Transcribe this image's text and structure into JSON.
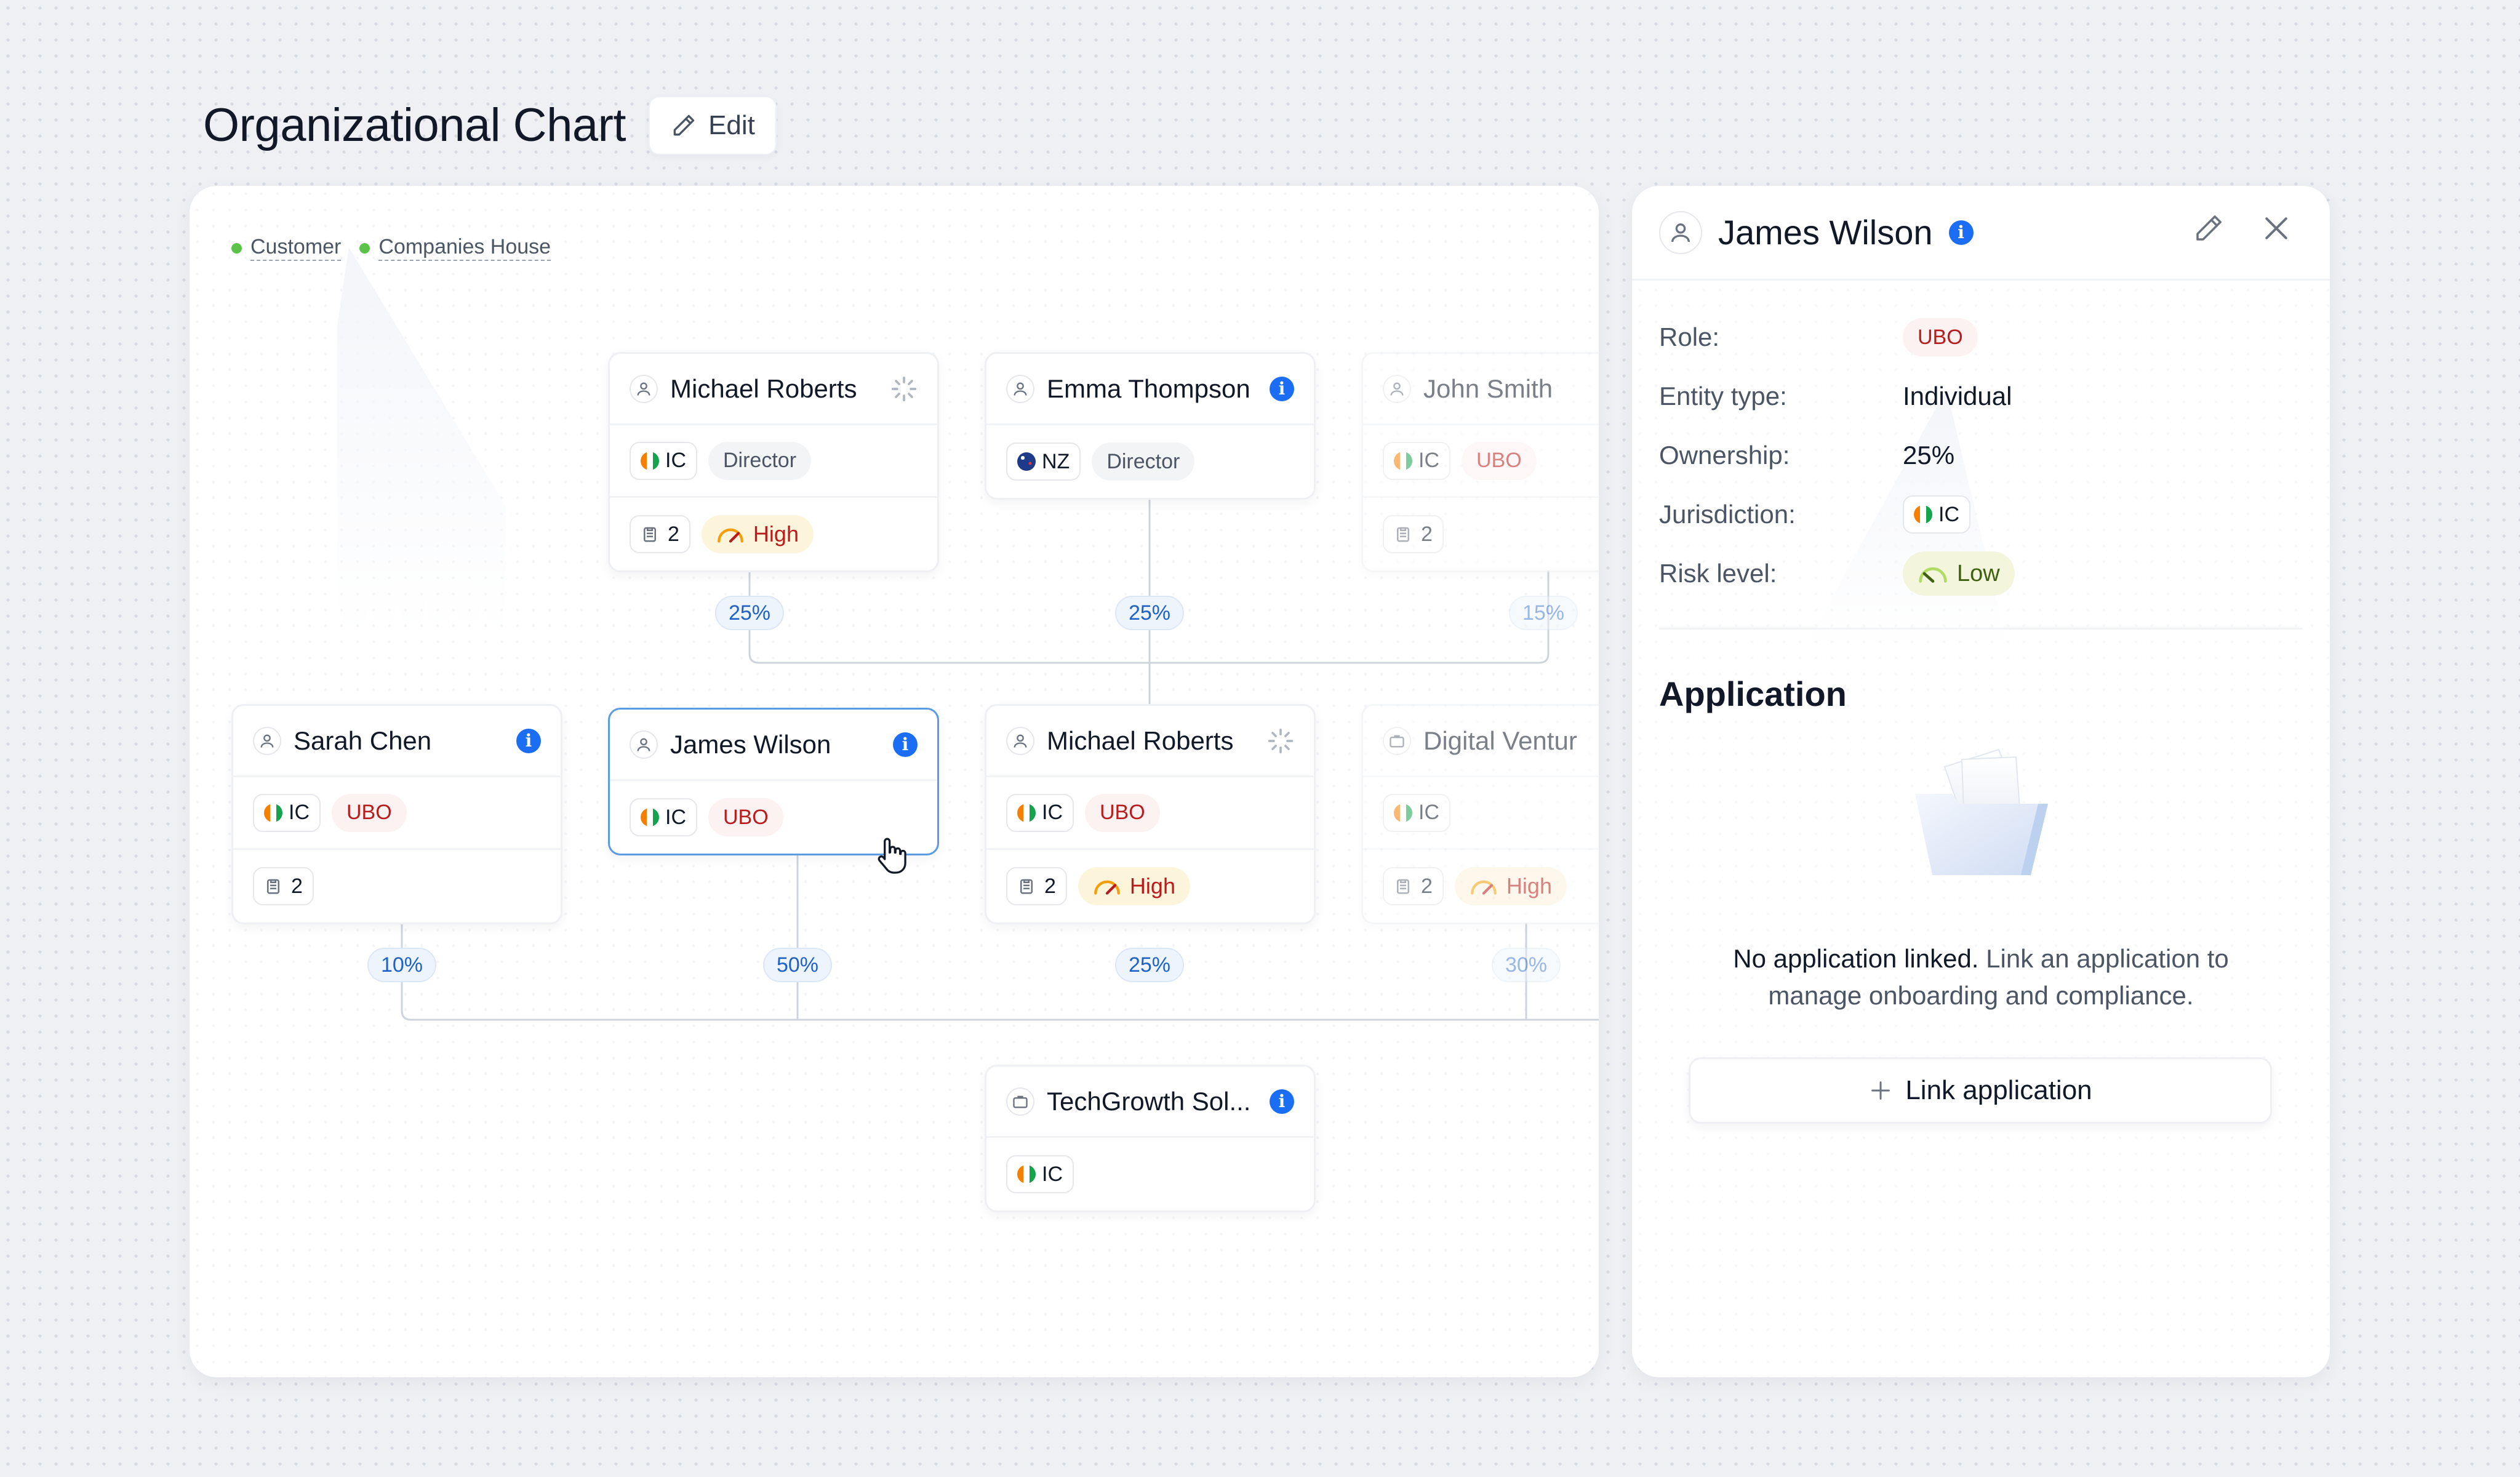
{
  "header": {
    "title": "Organizational Chart",
    "edit_label": "Edit"
  },
  "legend": [
    {
      "label": "Customer",
      "color": "#5cc34a"
    },
    {
      "label": "Companies House",
      "color": "#5cc34a"
    }
  ],
  "nodes": {
    "michael_roberts_top": {
      "name": "Michael Roberts",
      "type": "person",
      "status_icon": "spinner-icon",
      "jurisdiction": "IC",
      "role": "Director",
      "documents": "2",
      "risk": "High"
    },
    "emma_thompson": {
      "name": "Emma Thompson",
      "type": "person",
      "status_icon": "info-icon",
      "jurisdiction": "NZ",
      "role": "Director"
    },
    "john_smith": {
      "name": "John Smith",
      "type": "person",
      "jurisdiction": "IC",
      "role": "UBO",
      "documents": "2"
    },
    "sarah_chen": {
      "name": "Sarah Chen",
      "type": "person",
      "status_icon": "info-icon",
      "jurisdiction": "IC",
      "role": "UBO",
      "documents": "2"
    },
    "james_wilson": {
      "name": "James Wilson",
      "type": "person",
      "status_icon": "info-icon",
      "jurisdiction": "IC",
      "role": "UBO",
      "selected": true
    },
    "michael_roberts_mid": {
      "name": "Michael Roberts",
      "type": "person",
      "status_icon": "spinner-icon",
      "jurisdiction": "IC",
      "role": "UBO",
      "documents": "2",
      "risk": "High"
    },
    "digital_ventures": {
      "name": "Digital Ventur",
      "type": "company",
      "jurisdiction": "IC",
      "documents": "2",
      "risk": "High"
    },
    "techgrowth": {
      "name": "TechGrowth Sol...",
      "type": "company",
      "status_icon": "info-icon",
      "jurisdiction": "IC"
    }
  },
  "ownership": {
    "michael_roberts_top": "25%",
    "emma_thompson": "25%",
    "john_smith": "15%",
    "sarah_chen": "10%",
    "james_wilson": "50%",
    "michael_roberts_mid": "25%",
    "digital_ventures": "30%"
  },
  "panel": {
    "name": "James Wilson",
    "fields": [
      {
        "label": "Role:",
        "value": "UBO"
      },
      {
        "label": "Entity type:",
        "value": "Individual"
      },
      {
        "label": "Ownership:",
        "value": "25%"
      },
      {
        "label": "Jurisdiction:",
        "value": "IC"
      },
      {
        "label": "Risk level:",
        "value": "Low"
      }
    ],
    "section_title": "Application",
    "empty_strong": "No application linked.",
    "empty_rest": " Link an application to manage onboarding and compliance.",
    "link_button": "Link application"
  },
  "colors": {
    "accent": "#1b6ef3",
    "selected_border": "#5a9be6",
    "ubo_text": "#b91c1c",
    "high_risk_bg": "#fdf4dc",
    "low_risk_bg": "#f3f5dd",
    "legend_dot": "#5cc34a"
  }
}
